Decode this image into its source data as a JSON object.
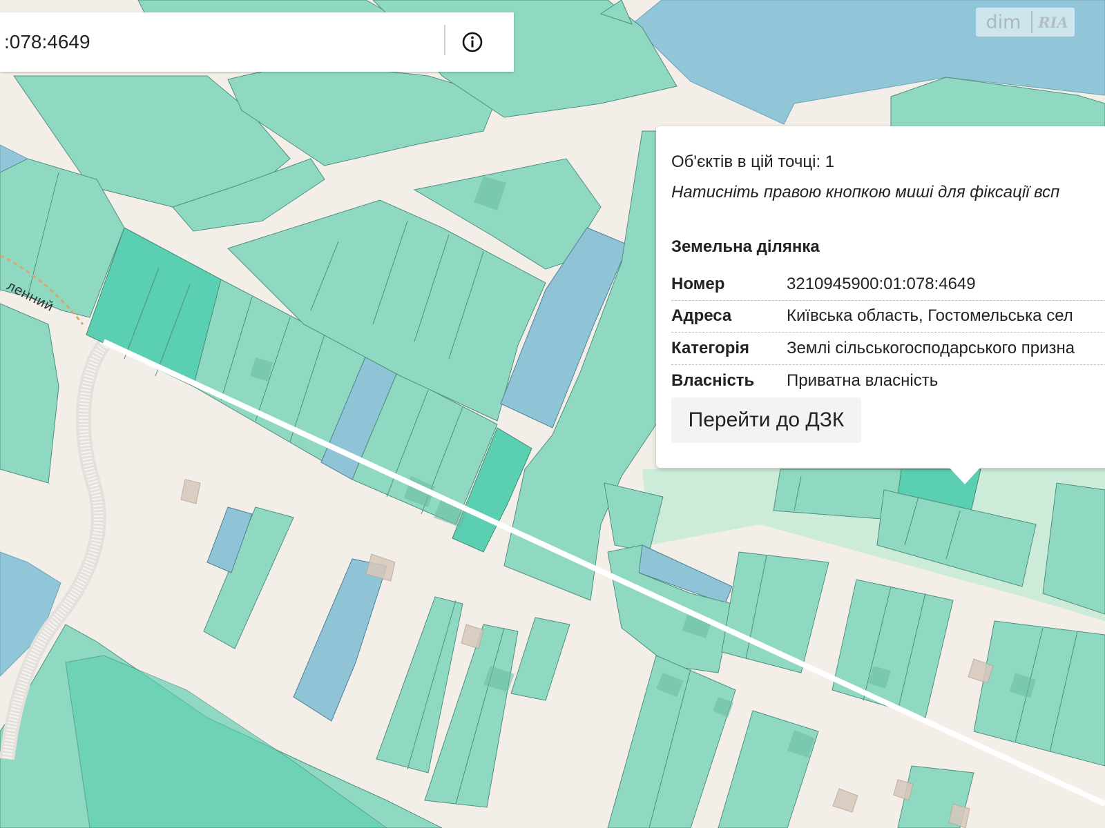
{
  "search": {
    "value": ":078:4649"
  },
  "logo": {
    "left_text": "dim",
    "right_text": "RIA"
  },
  "map": {
    "street_label": "ленний",
    "parcel_colors": {
      "agricultural": "#8fd9c2",
      "highlighted": "#5bcfb1",
      "other": "#8fc4d6",
      "road": "#f3eee8"
    }
  },
  "popup": {
    "objects_count": "Об'єктів в цій точці: 1",
    "hint": "Натисніть правою кнопкою миші для фіксації всп",
    "section_title": "Земельна ділянка",
    "attributes": [
      {
        "key": "Номер",
        "value": "3210945900:01:078:4649"
      },
      {
        "key": "Адреса",
        "value": "Київська область, Гостомельська сел"
      },
      {
        "key": "Категорія",
        "value": "Землі сільськогосподарського призна"
      },
      {
        "key": "Власність",
        "value": "Приватна власність"
      }
    ],
    "goto_button": "Перейти до ДЗК"
  }
}
